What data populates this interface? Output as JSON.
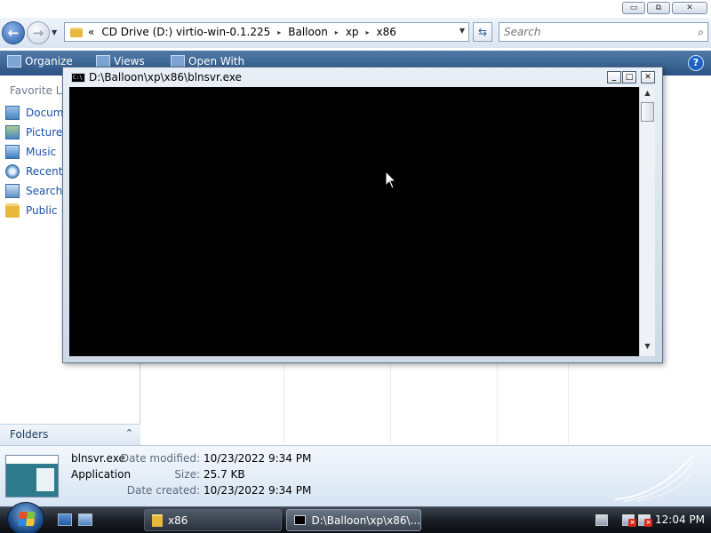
{
  "explorer": {
    "caption_buttons": {
      "minimize": "▭",
      "maximize": "⧉",
      "close": "✕"
    },
    "address": {
      "overflow": "«",
      "crumbs": [
        "CD Drive (D:) virtio-win-0.1.225",
        "Balloon",
        "xp",
        "x86"
      ],
      "separator": "▸",
      "dropdown": "▼"
    },
    "nav_buttons": {
      "back": "←",
      "forward": "→",
      "history": "▼"
    },
    "refresh": "⇆",
    "search": {
      "placeholder": "Search",
      "icon": "search-icon"
    },
    "toolbar": {
      "organize": "Organize",
      "views": "Views",
      "open_with": "Open With",
      "help": "?"
    },
    "nav_pane": {
      "heading": "Favorite Links",
      "links": [
        {
          "label": "Documents",
          "icon": "documents-icon"
        },
        {
          "label": "Pictures",
          "icon": "pictures-icon"
        },
        {
          "label": "Music",
          "icon": "music-icon"
        },
        {
          "label": "Recently Changed",
          "icon": "recent-icon"
        },
        {
          "label": "Searches",
          "icon": "searches-icon"
        },
        {
          "label": "Public",
          "icon": "folder-icon"
        }
      ]
    },
    "folders": {
      "label": "Folders",
      "toggle": "⌃"
    },
    "details": {
      "name": "blnsvr.exe",
      "type": "Application",
      "rows": [
        {
          "label": "Date modified:",
          "value": "10/23/2022 9:34 PM"
        },
        {
          "label": "Size:",
          "value": "25.7 KB"
        },
        {
          "label": "Date created:",
          "value": "10/23/2022 9:34 PM"
        }
      ]
    }
  },
  "console": {
    "title": "D:\\Balloon\\xp\\x86\\blnsvr.exe",
    "icon_text": "C:\\",
    "buttons": {
      "minimize": "_",
      "maximize": "□",
      "close": "✕"
    },
    "scroll": {
      "up": "▲",
      "down": "▼"
    }
  },
  "taskbar": {
    "buttons": [
      {
        "label": "x86",
        "icon": "folder-icon"
      },
      {
        "label": "D:\\Balloon\\xp\\x86\\...",
        "icon": "console-icon"
      }
    ],
    "clock": "12:04 PM"
  }
}
